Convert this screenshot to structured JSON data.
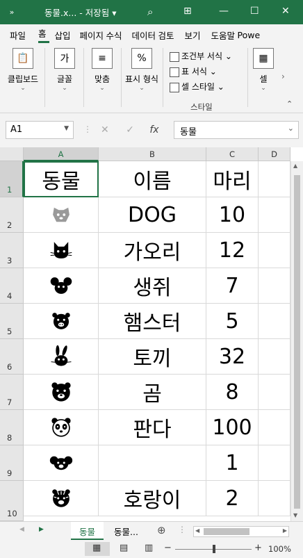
{
  "title": {
    "file": "동물.x...",
    "status": "저장됨"
  },
  "ribbon_tabs": [
    "파일",
    "홈",
    "삽입",
    "페이지",
    "수식",
    "데이터",
    "검토",
    "보기",
    "도움말",
    "Powe"
  ],
  "ribbon": {
    "clipboard": "클립보드",
    "font": "글꼴",
    "align": "맞춤",
    "number": "표시 형식",
    "number_icon": "%",
    "cond_format": "조건부 서식",
    "table_format": "표 서식",
    "cell_style": "셀 스타일",
    "styles_group": "스타일",
    "cells": "셀"
  },
  "formula_bar": {
    "cell_ref": "A1",
    "fx": "fx",
    "value": "동물"
  },
  "columns": [
    "A",
    "B",
    "C",
    "D"
  ],
  "rows": [
    "1",
    "2",
    "3",
    "4",
    "5",
    "6",
    "7",
    "8",
    "9",
    "10"
  ],
  "table": [
    {
      "animal_icon": "",
      "name": "이름",
      "count": "마리",
      "header_a": "동물"
    },
    {
      "animal_icon": "dog-icon",
      "name": "DOG",
      "count": "10"
    },
    {
      "animal_icon": "cat-icon",
      "name": "가오리",
      "count": "12"
    },
    {
      "animal_icon": "mouse-icon",
      "name": "생쥐",
      "count": "7"
    },
    {
      "animal_icon": "hamster-icon",
      "name": "햄스터",
      "count": "5"
    },
    {
      "animal_icon": "rabbit-icon",
      "name": "토끼",
      "count": "32"
    },
    {
      "animal_icon": "bear-icon",
      "name": "곰",
      "count": "8"
    },
    {
      "animal_icon": "panda-icon",
      "name": "판다",
      "count": "100"
    },
    {
      "animal_icon": "koala-icon",
      "name": "",
      "count": "1"
    },
    {
      "animal_icon": "tiger-icon",
      "name": "호랑이",
      "count": "2"
    }
  ],
  "sheets": [
    "동물",
    "동물..."
  ],
  "status": {
    "zoom": "100%"
  },
  "colors": {
    "accent": "#217346"
  }
}
